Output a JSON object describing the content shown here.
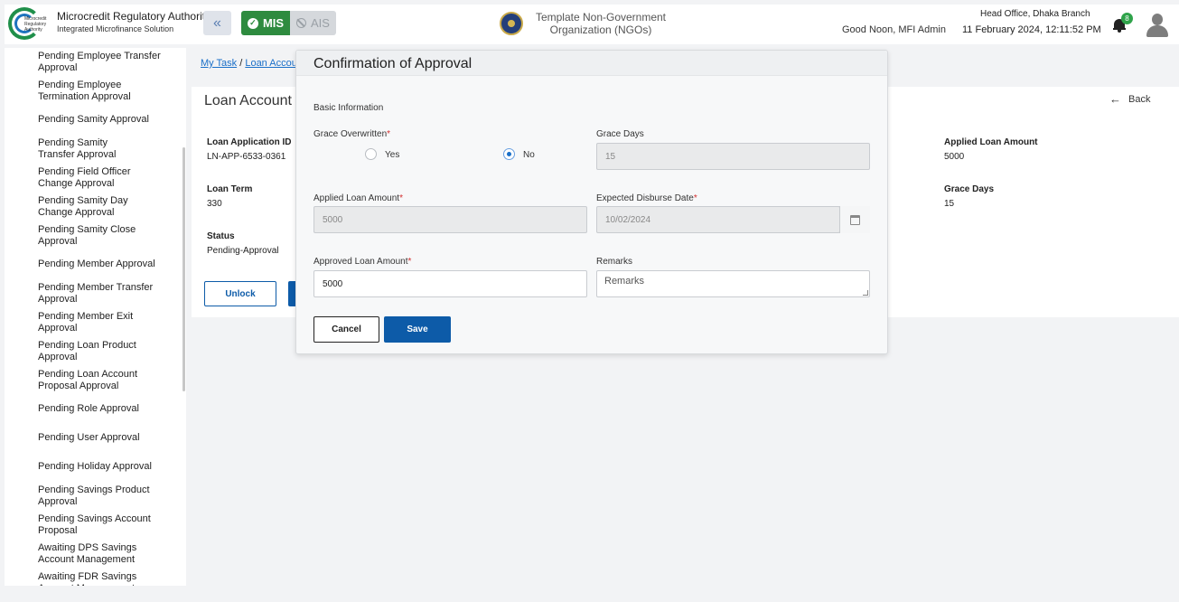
{
  "header": {
    "logo_text": "Microcredit Regulatory Authority",
    "app_title": "Microcredit Regulatory Authority",
    "app_subtitle": "Integrated Microfinance Solution",
    "collapse_icon": "«",
    "mis_label": "MIS",
    "ais_label": "AIS",
    "org_name_line1": "Template Non-Government",
    "org_name_line2": "Organization (NGOs)",
    "greeting": "Good Noon, MFI Admin",
    "branch": "Head Office, Dhaka Branch",
    "datetime": "11 February 2024, 12:11:52 PM",
    "notification_count": "8",
    "colors": {
      "mis": "#2e8b3f",
      "accent": "#0d5ba8"
    }
  },
  "sidebar": {
    "items": [
      {
        "label": "Pending Employee Transfer Approval"
      },
      {
        "label": "Pending Employee Termination Approval"
      },
      {
        "label": "Pending Samity Approval"
      },
      {
        "label": "Pending Samity Transfer Approval"
      },
      {
        "label": "Pending Field Officer Change Approval"
      },
      {
        "label": "Pending Samity Day Change Approval"
      },
      {
        "label": "Pending Samity Close Approval"
      },
      {
        "label": "Pending Member Approval"
      },
      {
        "label": "Pending Member Transfer Approval"
      },
      {
        "label": "Pending Member Exit Approval"
      },
      {
        "label": "Pending Loan Product Approval"
      },
      {
        "label": "Pending Loan Account Proposal Approval"
      },
      {
        "label": "Pending Role Approval"
      },
      {
        "label": "Pending User Approval"
      },
      {
        "label": "Pending Holiday Approval"
      },
      {
        "label": "Pending Savings Product Approval"
      },
      {
        "label": "Pending Savings Account Proposal"
      },
      {
        "label": "Awaiting DPS Savings Account Management"
      },
      {
        "label": "Awaiting FDR Savings Account Management"
      }
    ]
  },
  "breadcrumb": {
    "my_task": "My Task",
    "separator": "/",
    "loan_account": "Loan Account"
  },
  "page": {
    "title": "Loan Account",
    "back_label": "Back",
    "fields": {
      "loan_application_id_label": "Loan Application ID",
      "loan_application_id_value": "LN-APP-6533-0361",
      "loan_term_label": "Loan Term",
      "loan_term_value": "330",
      "status_label": "Status",
      "status_value": "Pending-Approval",
      "applied_loan_amount_label": "Applied Loan Amount",
      "applied_loan_amount_value": "5000",
      "grace_days_label": "Grace Days",
      "grace_days_value": "15"
    },
    "unlock_label": "Unlock"
  },
  "modal": {
    "title": "Confirmation of Approval",
    "section": "Basic Information",
    "grace_overwritten_label": "Grace Overwritten",
    "grace_yes": "Yes",
    "grace_no": "No",
    "grace_selected": "No",
    "grace_days_label": "Grace Days",
    "grace_days_value": "15",
    "applied_amount_label": "Applied Loan Amount",
    "applied_amount_value": "5000",
    "disburse_date_label": "Expected Disburse Date",
    "disburse_date_value": "10/02/2024",
    "approved_amount_label": "Approved Loan Amount",
    "approved_amount_value": "5000",
    "remarks_label": "Remarks",
    "remarks_placeholder": "Remarks",
    "required_mark": "*",
    "cancel_label": "Cancel",
    "save_label": "Save"
  }
}
